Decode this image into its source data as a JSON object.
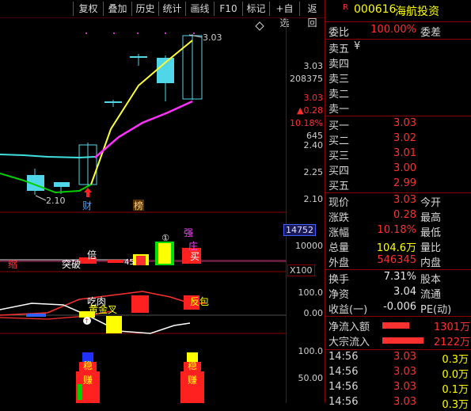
{
  "toolbar": {
    "buttons": [
      "复权",
      "叠加",
      "历史",
      "统计",
      "画线",
      "F10",
      "标记",
      "+自选",
      "返回"
    ]
  },
  "chart": {
    "labels": {
      "high": "3.03",
      "low": "2.10",
      "cai": "财",
      "bang": "榜",
      "qiang": "强",
      "zhuang": "庄",
      "mai": "买",
      "bei": "倍",
      "tupo": "突破",
      "xiao": "缩",
      "num45": "45",
      "x100": "X100",
      "chishen": "吃肉",
      "huangjin": "黄金叉",
      "fanbao": "反包",
      "wen1": "稳",
      "wen2": "稳",
      "zhuan1": "赚",
      "zhuan2": "赚",
      "circle": "①"
    }
  },
  "axis": {
    "p1": "3.03",
    "p2": "208375",
    "p3": "3.03",
    "p4": "▲0.28",
    "p5": "10.18%",
    "p6": "645",
    "t240": "2.40",
    "t225": "2.25",
    "t210": "2.10",
    "vol_box": "14752",
    "vol_10000": "10000",
    "m100": "100.0",
    "m0": "0.00",
    "b100": "100.0",
    "b50": "50.00"
  },
  "panel": {
    "code": "000616",
    "name": "海航投资",
    "r_icon": "R",
    "weibi_label": "委比",
    "weibi_val": "100.00%",
    "weicha_label": "委差",
    "sell": [
      {
        "label": "卖五",
        "extra": "¥"
      },
      {
        "label": "卖四",
        "extra": ""
      },
      {
        "label": "卖三",
        "extra": ""
      },
      {
        "label": "卖二",
        "extra": ""
      },
      {
        "label": "卖一",
        "extra": ""
      }
    ],
    "buy": [
      {
        "label": "买一",
        "price": "3.03"
      },
      {
        "label": "买二",
        "price": "3.02"
      },
      {
        "label": "买三",
        "price": "3.01"
      },
      {
        "label": "买四",
        "price": "3.00"
      },
      {
        "label": "买五",
        "price": "2.99"
      }
    ],
    "quote": [
      {
        "l1": "现价",
        "v1": "3.03",
        "l2": "今开"
      },
      {
        "l1": "涨跌",
        "v1": "0.28",
        "l2": "最高"
      },
      {
        "l1": "涨幅",
        "v1": "10.18%",
        "l2": "最低"
      },
      {
        "l1": "总量",
        "v1": "104.6万",
        "l2": "量比"
      },
      {
        "l1": "外盘",
        "v1": "546345",
        "l2": "内盘"
      }
    ],
    "stats": [
      {
        "l1": "换手",
        "v1": "7.31%",
        "l2": "股本"
      },
      {
        "l1": "净资",
        "v1": "3.04",
        "l2": "流通"
      },
      {
        "l1": "收益(一)",
        "v1": "-0.006",
        "l2": "PE(动)"
      }
    ],
    "flows": [
      {
        "label": "净流入额",
        "value": "1301万"
      },
      {
        "label": "大宗流入",
        "value": "2122万"
      }
    ],
    "ticks": [
      {
        "time": "14:56",
        "price": "3.03",
        "vol": "0.3万"
      },
      {
        "time": "14:56",
        "price": "3.03",
        "vol": "0.0万"
      },
      {
        "time": "14:56",
        "price": "3.03",
        "vol": "0.1万"
      },
      {
        "time": "14:56",
        "price": "3.03",
        "vol": "0.3万"
      }
    ]
  }
}
